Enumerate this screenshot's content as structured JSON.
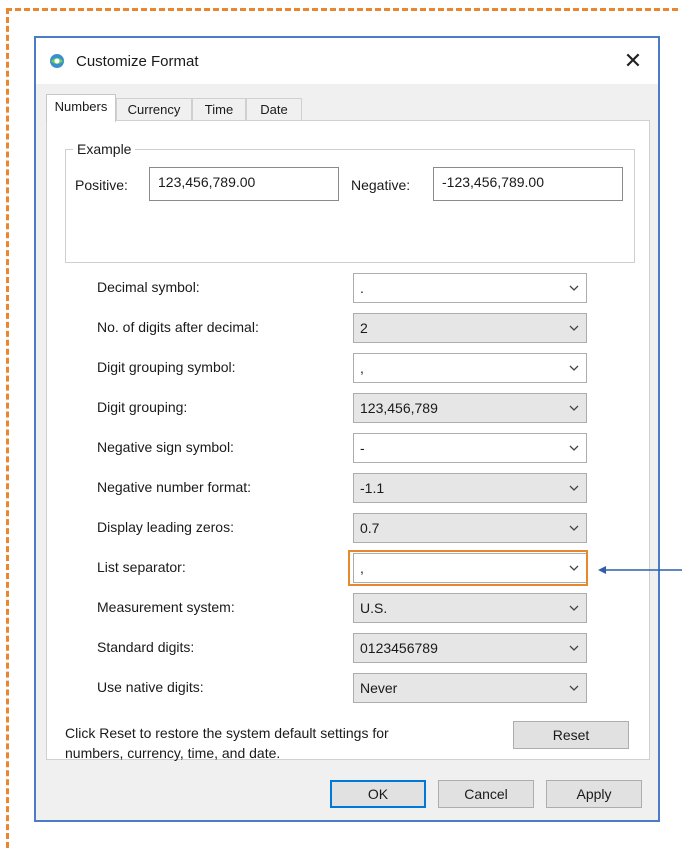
{
  "dialog": {
    "title": "Customize Format",
    "close_label": "✕"
  },
  "tabs": [
    {
      "label": "Numbers",
      "active": true
    },
    {
      "label": "Currency",
      "active": false
    },
    {
      "label": "Time",
      "active": false
    },
    {
      "label": "Date",
      "active": false
    }
  ],
  "example": {
    "legend": "Example",
    "positive_label": "Positive:",
    "positive_value": "123,456,789.00",
    "negative_label": "Negative:",
    "negative_value": "-123,456,789.00"
  },
  "settings": [
    {
      "label": "Decimal symbol:",
      "value": ".",
      "editable": true
    },
    {
      "label": "No. of digits after decimal:",
      "value": "2",
      "editable": false
    },
    {
      "label": "Digit grouping symbol:",
      "value": ",",
      "editable": true
    },
    {
      "label": "Digit grouping:",
      "value": "123,456,789",
      "editable": false
    },
    {
      "label": "Negative sign symbol:",
      "value": "-",
      "editable": true
    },
    {
      "label": "Negative number format:",
      "value": "-1.1",
      "editable": false
    },
    {
      "label": "Display leading zeros:",
      "value": "0.7",
      "editable": false
    },
    {
      "label": "List separator:",
      "value": ",",
      "editable": true,
      "highlighted": true
    },
    {
      "label": "Measurement system:",
      "value": "U.S.",
      "editable": false
    },
    {
      "label": "Standard digits:",
      "value": "0123456789",
      "editable": false
    },
    {
      "label": "Use native digits:",
      "value": "Never",
      "editable": false
    }
  ],
  "footer": {
    "reset_text_line1": "Click Reset to restore the system default settings for",
    "reset_text_line2": "numbers, currency, time, and date.",
    "reset_label": "Reset"
  },
  "buttons": {
    "ok": "OK",
    "cancel": "Cancel",
    "apply": "Apply"
  },
  "colors": {
    "annotation": "#e8872d",
    "dialog_border": "#4a7cc9",
    "arrow": "#2f5fa8"
  }
}
